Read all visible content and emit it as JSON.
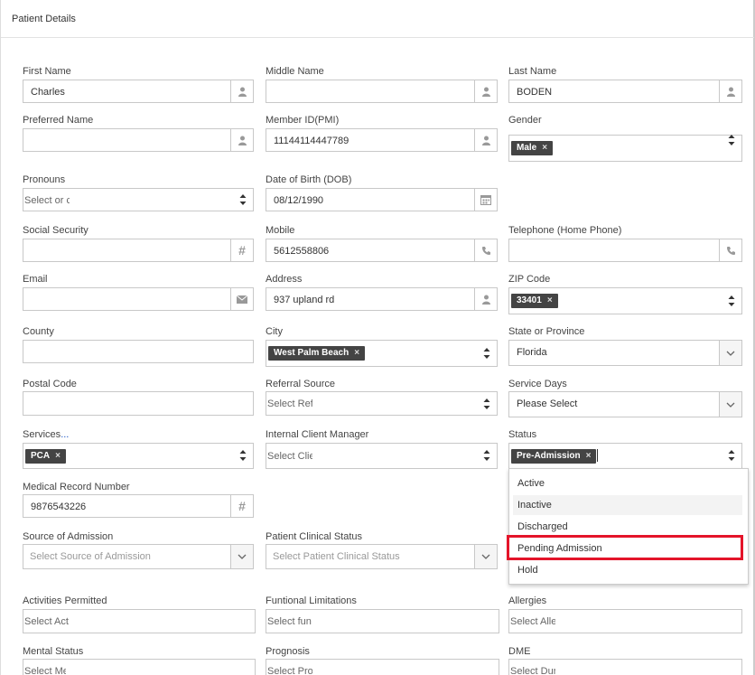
{
  "panel": {
    "title": "Patient Details"
  },
  "fields": {
    "first_name": {
      "label": "First Name",
      "value": "Charles",
      "icon": "user-icon"
    },
    "middle_name": {
      "label": "Middle Name",
      "value": "",
      "icon": "user-icon"
    },
    "last_name": {
      "label": "Last Name",
      "value": "BODEN",
      "icon": "user-icon"
    },
    "preferred_name": {
      "label": "Preferred Name",
      "value": "",
      "icon": "user-icon"
    },
    "member_id": {
      "label": "Member ID(PMI)",
      "value": "11144114447789",
      "icon": "user-icon"
    },
    "gender": {
      "label": "Gender",
      "tag": "Male"
    },
    "pronouns": {
      "label": "Pronouns",
      "placeholder": "Select or c"
    },
    "dob": {
      "label": "Date of Birth (DOB)",
      "value": "08/12/1990",
      "icon": "calendar-icon"
    },
    "ssn": {
      "label": "Social Security",
      "value": "",
      "icon": "hash-icon"
    },
    "mobile": {
      "label": "Mobile",
      "value": "5612558806",
      "icon": "phone-icon"
    },
    "telephone": {
      "label": "Telephone (Home Phone)",
      "value": "",
      "icon": "phone-icon"
    },
    "email": {
      "label": "Email",
      "value": "",
      "icon": "envelope-icon"
    },
    "address": {
      "label": "Address",
      "value": "937 upland rd",
      "icon": "user-icon"
    },
    "zip": {
      "label": "ZIP Code",
      "tag": "33401"
    },
    "county": {
      "label": "County",
      "value": ""
    },
    "city": {
      "label": "City",
      "tag": "West Palm Beach"
    },
    "state": {
      "label": "State or Province",
      "value": "Florida"
    },
    "postal": {
      "label": "Postal Code",
      "value": ""
    },
    "referral": {
      "label": "Referral Source",
      "placeholder": "Select Ref"
    },
    "service_days": {
      "label": "Service Days",
      "value": "Please Select"
    },
    "services": {
      "label": "Services",
      "label_link": "...",
      "tag": "PCA"
    },
    "client_manager": {
      "label": "Internal Client Manager",
      "placeholder": "Select Clie"
    },
    "status": {
      "label": "Status",
      "tag": "Pre-Admission"
    },
    "mrn": {
      "label": "Medical Record Number",
      "value": "9876543226",
      "icon": "hash-icon"
    },
    "source_admission": {
      "label": "Source of Admission",
      "placeholder": "Select Source of Admission"
    },
    "clinical_status": {
      "label": "Patient Clinical Status",
      "placeholder": "Select Patient Clinical Status"
    },
    "activities": {
      "label": "Activities Permitted",
      "placeholder": "Select Act"
    },
    "functional": {
      "label": "Funtional Limitations",
      "placeholder": "Select fun"
    },
    "allergies": {
      "label": "Allergies",
      "placeholder": "Select Alle"
    },
    "mental": {
      "label": "Mental Status",
      "placeholder": "Select Me"
    },
    "prognosis": {
      "label": "Prognosis",
      "placeholder": "Select Pro"
    },
    "dme": {
      "label": "DME",
      "placeholder": "Select Dur"
    }
  },
  "status_options": [
    "Active",
    "Inactive",
    "Discharged",
    "Pending Admission",
    "Hold"
  ],
  "colors": {
    "tag_bg": "#444444",
    "highlight": "#e4142a",
    "link": "#1a56c4"
  }
}
